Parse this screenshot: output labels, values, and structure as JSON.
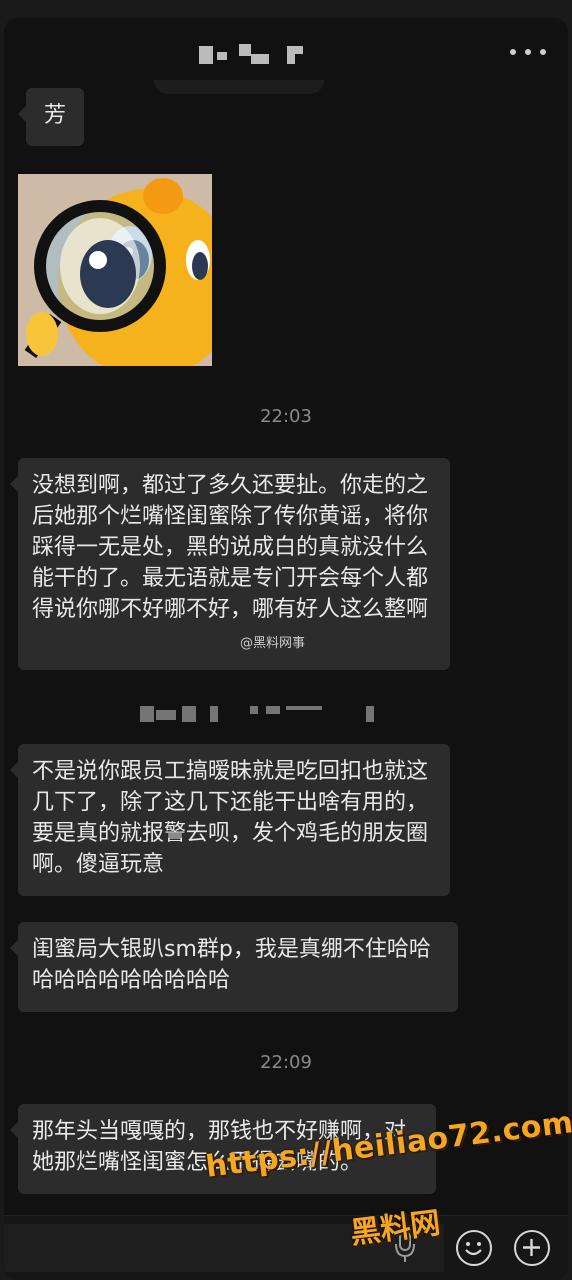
{
  "header": {
    "more_icon": "more-icon"
  },
  "messages": [
    {
      "id": "m0",
      "text": "芳"
    },
    {
      "id": "m2",
      "text": "没想到啊，都过了多久还要扯。你走的之后她那个烂嘴怪闺蜜除了传你黄谣，将你踩得一无是处，黑的说成白的真就没什么能干的了。最无语就是专门开会每个人都得说你哪不好哪不好，哪有好人这么整啊"
    },
    {
      "id": "m3",
      "text": "不是说你跟员工搞暧昧就是吃回扣也就这几下了，除了这几下还能干出啥有用的，要是真的就报警去呗，发个鸡毛的朋友圈啊。傻逼玩意"
    },
    {
      "id": "m4",
      "text": "闺蜜局大银趴sm群p，我是真绷不住哈哈哈哈哈哈哈哈哈哈哈"
    },
    {
      "id": "m5",
      "text": "那年头当嘎嘎的，那钱也不好赚啊，对她那烂嘴怪闺蜜怎么下得去嘴的。"
    }
  ],
  "timestamps": [
    "22:03",
    "22:09"
  ],
  "inline_watermark": "@黑料网事",
  "sticker": {
    "icon": "duck-magnifier-sticker"
  },
  "input_bar": {
    "voice_icon": "microphone-icon",
    "emoji_icon": "emoji-icon",
    "plus_icon": "plus-icon"
  },
  "overlay": {
    "url": "https://heiliao72.com",
    "name": "黑料网"
  }
}
